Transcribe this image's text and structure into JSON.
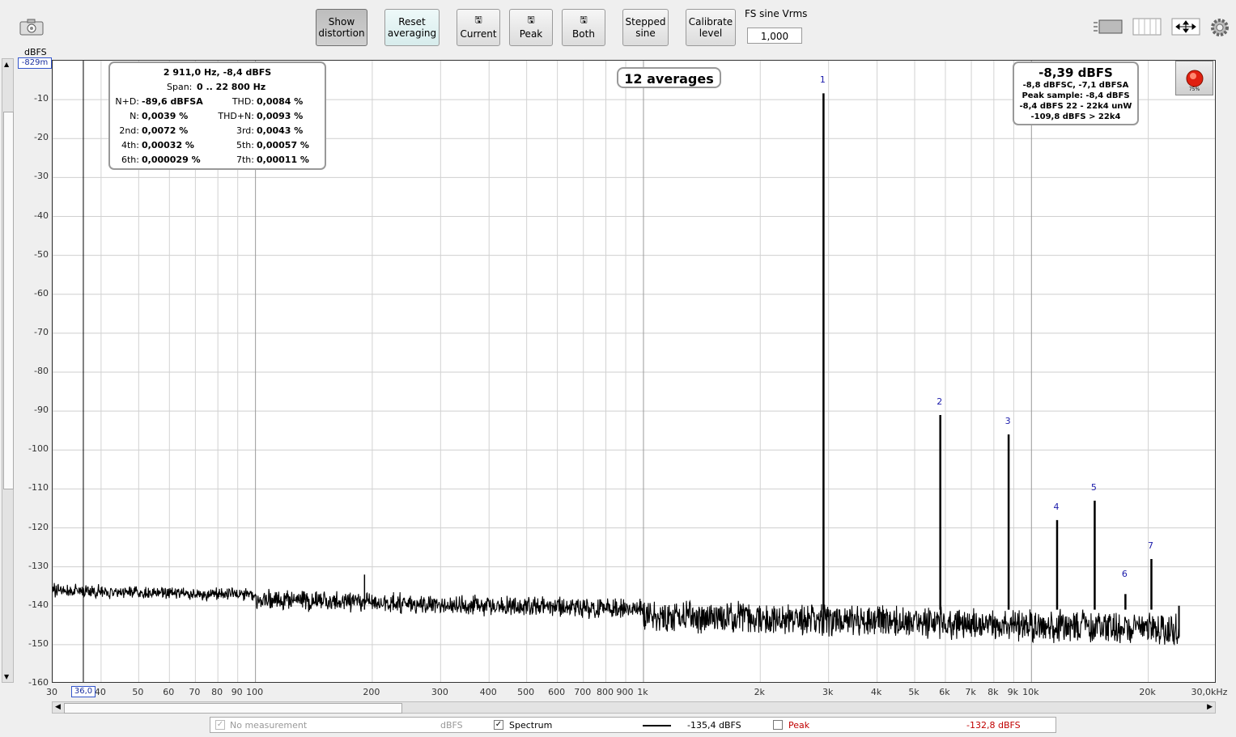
{
  "toolbar": {
    "camera_icon": "camera-icon",
    "show_distortion": [
      "Show",
      "distortion"
    ],
    "reset_averaging": [
      "Reset",
      "averaging"
    ],
    "current": "Current",
    "peak": "Peak",
    "both": "Both",
    "stepped_sine": [
      "Stepped",
      "sine"
    ],
    "calibrate_level": [
      "Calibrate",
      "level"
    ],
    "fs_sine_label": "FS sine Vrms",
    "fs_sine_value": "1,000"
  },
  "axis": {
    "unit_label": "dBFS",
    "top_readout": "-829m",
    "cursor_readout": "36,0",
    "y_ticks": [
      "-10",
      "-20",
      "-30",
      "-40",
      "-50",
      "-60",
      "-70",
      "-80",
      "-90",
      "-100",
      "-110",
      "-120",
      "-130",
      "-140",
      "-150",
      "-160"
    ],
    "x_ticks": [
      "30",
      "40",
      "50",
      "60",
      "70",
      "80",
      "90",
      "100",
      "200",
      "300",
      "400",
      "500",
      "600",
      "700",
      "800",
      "900",
      "1k",
      "2k",
      "3k",
      "4k",
      "5k",
      "6k",
      "7k",
      "8k",
      "9k",
      "10k",
      "20k",
      "30,0kHz"
    ]
  },
  "distortion_box": {
    "header": "2 911,0 Hz, -8,4 dBFS",
    "span_label": "Span:",
    "span_value": "0 .. 22 800 Hz",
    "rows": [
      {
        "l1": "N+D:",
        "v1": "-89,6 dBFSA",
        "l2": "THD:",
        "v2": "0,0084 %"
      },
      {
        "l1": "N:",
        "v1": "0,0039 %",
        "l2": "THD+N:",
        "v2": "0,0093 %"
      },
      {
        "l1": "2nd:",
        "v1": "0,0072 %",
        "l2": "3rd:",
        "v2": "0,0043 %"
      },
      {
        "l1": "4th:",
        "v1": "0,00032 %",
        "l2": "5th:",
        "v2": "0,00057 %"
      },
      {
        "l1": "6th:",
        "v1": "0,000029 %",
        "l2": "7th:",
        "v2": "0,00011 %"
      }
    ]
  },
  "averages_label": "12 averages",
  "level_box": {
    "main": "-8,39 dBFS",
    "line1": "-8,8 dBFSC, -7,1 dBFSA",
    "line2": "Peak sample: -8,4 dBFS",
    "line3": "-8,4 dBFS 22 - 22k4 unW",
    "line4": "-109,8 dBFS > 22k4"
  },
  "record_percent": "75%",
  "chart_data": {
    "type": "line",
    "x_scale": "log",
    "xlim": [
      30,
      30000
    ],
    "ylim": [
      -160,
      0
    ],
    "ylabel": "dBFS",
    "grid": true,
    "harmonics": [
      {
        "label": "1",
        "freq": 2911,
        "level": -8.4
      },
      {
        "label": "2",
        "freq": 5822,
        "level": -91
      },
      {
        "label": "3",
        "freq": 8733,
        "level": -96
      },
      {
        "label": "4",
        "freq": 11644,
        "level": -118
      },
      {
        "label": "5",
        "freq": 14555,
        "level": -113
      },
      {
        "label": "6",
        "freq": 17466,
        "level": -137
      },
      {
        "label": "7",
        "freq": 20377,
        "level": -128
      }
    ],
    "noise_floor_db": [
      -135,
      -140,
      -145
    ]
  },
  "legend": {
    "no_measurement": "No measurement",
    "no_measurement_unit": "dBFS",
    "spectrum_label": "Spectrum",
    "spectrum_value": "-135,4 dBFS",
    "peak_label": "Peak",
    "peak_value": "-132,8 dBFS",
    "peak_color": "#c00000"
  }
}
